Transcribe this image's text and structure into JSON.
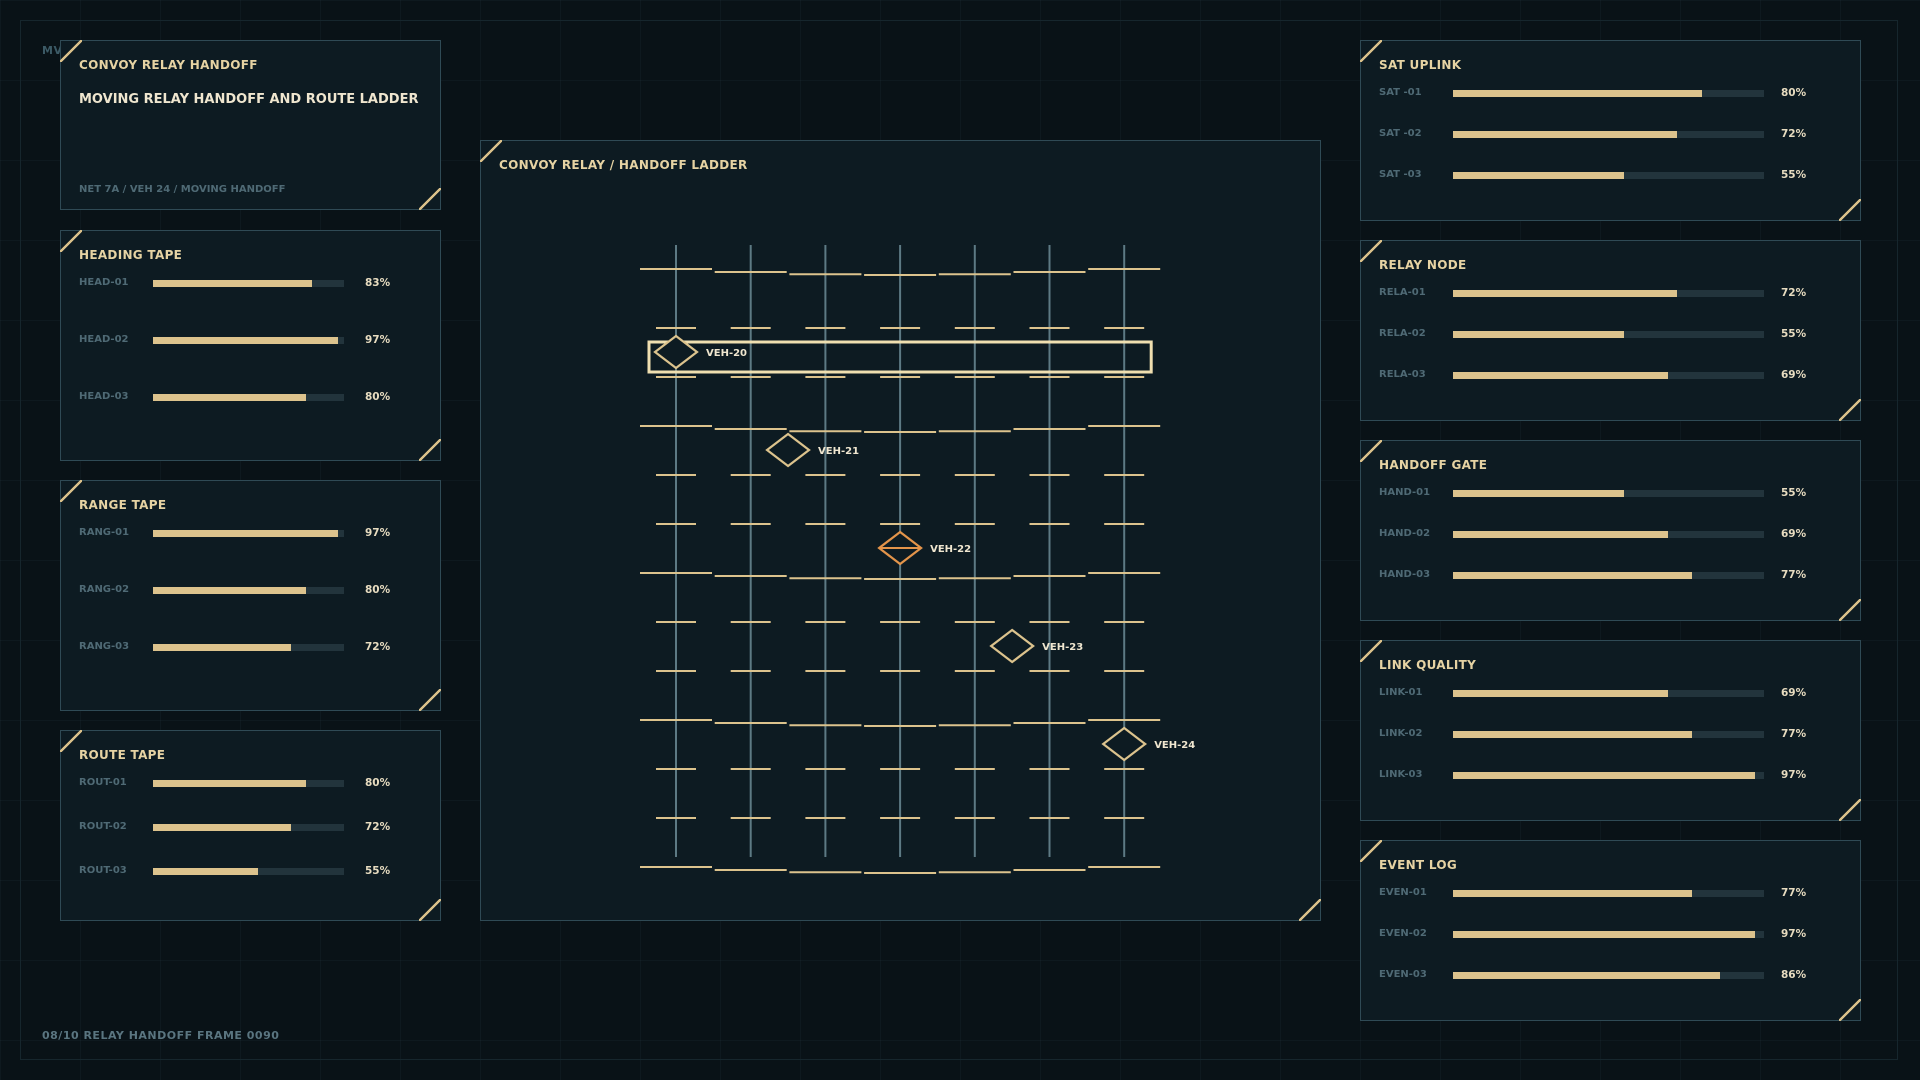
{
  "corner_tag": "MV",
  "footer": "08/10  RELAY HANDOFF  FRAME 0090",
  "header_panel": {
    "title": "CONVOY RELAY HANDOFF",
    "subtitle": "MOVING RELAY HANDOFF AND ROUTE LADDER",
    "meta": "NET 7A / VEH 24 / MOVING HANDOFF"
  },
  "left_panels": [
    {
      "title": "HEADING TAPE",
      "rows": [
        {
          "label": "HEAD-01",
          "value": 83,
          "text": "83%"
        },
        {
          "label": "HEAD-02",
          "value": 97,
          "text": "97%"
        },
        {
          "label": "HEAD-03",
          "value": 80,
          "text": "80%"
        }
      ]
    },
    {
      "title": "RANGE TAPE",
      "rows": [
        {
          "label": "RANG-01",
          "value": 97,
          "text": "97%"
        },
        {
          "label": "RANG-02",
          "value": 80,
          "text": "80%"
        },
        {
          "label": "RANG-03",
          "value": 72,
          "text": "72%"
        }
      ]
    },
    {
      "title": "ROUTE TAPE",
      "rows": [
        {
          "label": "ROUT-01",
          "value": 80,
          "text": "80%"
        },
        {
          "label": "ROUT-02",
          "value": 72,
          "text": "72%"
        },
        {
          "label": "ROUT-03",
          "value": 55,
          "text": "55%"
        }
      ]
    }
  ],
  "right_panels": [
    {
      "title": "SAT UPLINK",
      "rows": [
        {
          "label": "SAT -01",
          "value": 80,
          "text": "80%"
        },
        {
          "label": "SAT -02",
          "value": 72,
          "text": "72%"
        },
        {
          "label": "SAT -03",
          "value": 55,
          "text": "55%"
        }
      ]
    },
    {
      "title": "RELAY NODE",
      "rows": [
        {
          "label": "RELA-01",
          "value": 72,
          "text": "72%"
        },
        {
          "label": "RELA-02",
          "value": 55,
          "text": "55%"
        },
        {
          "label": "RELA-03",
          "value": 69,
          "text": "69%"
        }
      ]
    },
    {
      "title": "HANDOFF GATE",
      "rows": [
        {
          "label": "HAND-01",
          "value": 55,
          "text": "55%"
        },
        {
          "label": "HAND-02",
          "value": 69,
          "text": "69%"
        },
        {
          "label": "HAND-03",
          "value": 77,
          "text": "77%"
        }
      ]
    },
    {
      "title": "LINK QUALITY",
      "rows": [
        {
          "label": "LINK-01",
          "value": 69,
          "text": "69%"
        },
        {
          "label": "LINK-02",
          "value": 77,
          "text": "77%"
        },
        {
          "label": "LINK-03",
          "value": 97,
          "text": "97%"
        }
      ]
    },
    {
      "title": "EVENT LOG",
      "rows": [
        {
          "label": "EVEN-01",
          "value": 77,
          "text": "77%"
        },
        {
          "label": "EVEN-02",
          "value": 97,
          "text": "97%"
        },
        {
          "label": "EVEN-03",
          "value": 86,
          "text": "86%"
        }
      ]
    }
  ],
  "ladder_panel": {
    "title": "CONVOY RELAY / HANDOFF LADDER",
    "lanes": 7,
    "rungs": 12,
    "vehicles": [
      {
        "label": "VEH-20",
        "lane": 0,
        "rung": 2,
        "active": false
      },
      {
        "label": "VEH-21",
        "lane": 1.5,
        "rung": 4,
        "active": false
      },
      {
        "label": "VEH-22",
        "lane": 3,
        "rung": 6,
        "active": true
      },
      {
        "label": "VEH-23",
        "lane": 4.5,
        "rung": 8,
        "active": false
      },
      {
        "label": "VEH-24",
        "lane": 6,
        "rung": 10,
        "active": false
      }
    ]
  },
  "colors": {
    "accent": "#dcc38d",
    "active": "#e3944a",
    "panel_border": "#2f4a55",
    "lane": "#5d7a84"
  }
}
